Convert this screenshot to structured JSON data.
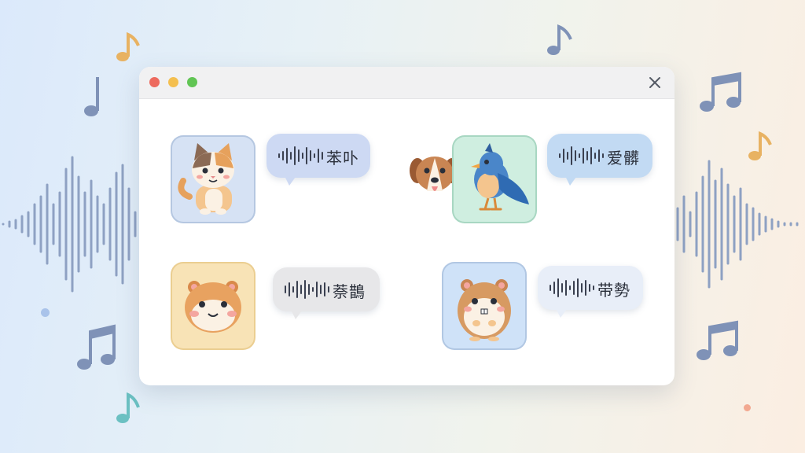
{
  "window": {
    "traffic_lights": [
      "#ed6a5e",
      "#f4bf4f",
      "#61c554"
    ],
    "close_icon": "close-icon"
  },
  "cards": [
    {
      "animal": "cat",
      "tile_color": "#d6e2f4",
      "bubble_color": "#cdd9f3",
      "text": "苯卟"
    },
    {
      "animal": "bird",
      "tile_color": "#cfeee0",
      "bubble_color": "#c2daf3",
      "text": "爱髒"
    },
    {
      "animal": "hamster",
      "tile_color": "#f8e3b6",
      "bubble_color": "#e7e7e9",
      "text": "萘鵲"
    },
    {
      "animal": "hamster",
      "tile_color": "#cfe2f8",
      "bubble_color": "#e8eef8",
      "text": "带勢"
    }
  ],
  "decorations": {
    "icons": [
      "music-note-icon",
      "sound-wave-icon"
    ],
    "colors": {
      "note_blue": "#7f92b7",
      "note_gold": "#e8b262",
      "note_teal": "#6bc0c2"
    }
  }
}
